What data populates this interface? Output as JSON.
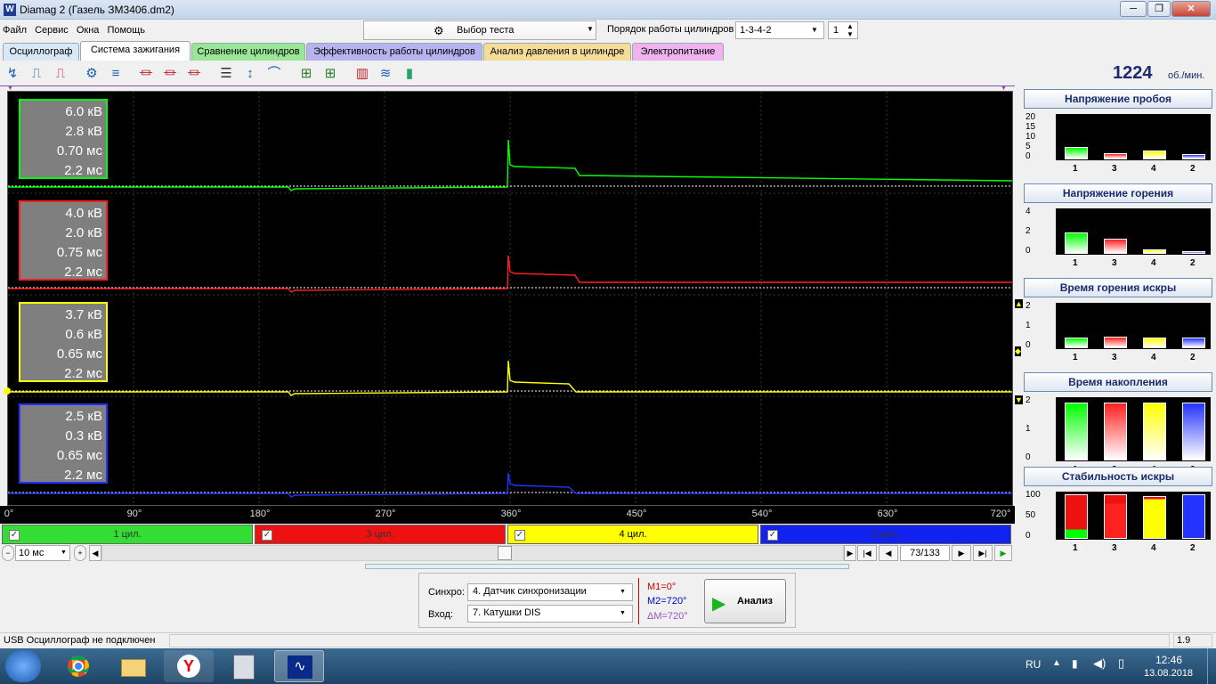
{
  "window": {
    "title": "Diamag 2 (Газель ЗМ3406.dm2)",
    "icon_name": "diamag-app-icon"
  },
  "menu": [
    "Файл",
    "Сервис",
    "Окна",
    "Помощь"
  ],
  "test_select": {
    "label": "Выбор теста"
  },
  "firing_order": {
    "label": "Порядок работы цилиндров",
    "value": "1-3-4-2",
    "cylinder": "1"
  },
  "tabs": [
    {
      "label": "Осциллограф",
      "color": "#d9e8f7"
    },
    {
      "label": "Система зажигания",
      "color": "#ffffff"
    },
    {
      "label": "Сравнение цилиндров",
      "color": "#99e699"
    },
    {
      "label": "Эффективность работы цилиндров",
      "color": "#b8b3f0"
    },
    {
      "label": "Анализ давления в цилиндре",
      "color": "#f5dd99"
    },
    {
      "label": "Электропитание",
      "color": "#efb3ef"
    }
  ],
  "rpm": {
    "value": "1224",
    "unit": "об./мин."
  },
  "channels": [
    {
      "name": "1 цил.",
      "color": "#00ff00",
      "bg": "#33dd33",
      "v1": "6.0 кВ",
      "v2": "2.8 кВ",
      "t1": "0.70 мс",
      "t2": "2.2 мс"
    },
    {
      "name": "3 цил.",
      "color": "#ff2020",
      "bg": "#ee1111",
      "v1": "4.0 кВ",
      "v2": "2.0 кВ",
      "t1": "0.75 мс",
      "t2": "2.2 мс"
    },
    {
      "name": "4 цил.",
      "color": "#ffff00",
      "bg": "#ffff00",
      "v1": "3.7 кВ",
      "v2": "0.6 кВ",
      "t1": "0.65 мс",
      "t2": "2.2 мс"
    },
    {
      "name": "2 цил.",
      "color": "#2233ff",
      "bg": "#1122ee",
      "v1": "2.5 кВ",
      "v2": "0.3 кВ",
      "t1": "0.65 мс",
      "t2": "2.2 мс"
    }
  ],
  "x_ticks": [
    "0°",
    "90°",
    "180°",
    "270°",
    "360°",
    "450°",
    "540°",
    "630°",
    "720°"
  ],
  "nav": {
    "timebase": "10 мс",
    "position": "73/133"
  },
  "panels": [
    {
      "title": "Напряжение пробоя",
      "y_ticks": [
        "20",
        "15",
        "10",
        "5",
        "0"
      ],
      "y_max": 20,
      "values": [
        6,
        2.8,
        4,
        2.5
      ]
    },
    {
      "title": "Напряжение горения",
      "y_ticks": [
        "4",
        "2",
        "0"
      ],
      "y_max": 5.5,
      "values": [
        2.8,
        2.0,
        0.6,
        0.3
      ]
    },
    {
      "title": "Время горения искры",
      "y_ticks": [
        "2",
        "1",
        "0"
      ],
      "y_max": 2.7,
      "values": [
        0.7,
        0.75,
        0.65,
        0.65
      ]
    },
    {
      "title": "Время накопления",
      "y_ticks": [
        "2",
        "1",
        "0"
      ],
      "y_max": 2.3,
      "values": [
        2.2,
        2.2,
        2.2,
        2.2
      ]
    },
    {
      "title": "Стабильность искры",
      "y_ticks": [
        "100",
        "50",
        "0"
      ],
      "y_max": 100,
      "values": [
        100,
        100,
        95,
        100
      ],
      "stable": [
        20,
        80,
        95,
        100
      ]
    }
  ],
  "panel_x_labels": [
    "1",
    "3",
    "4",
    "2"
  ],
  "sync": {
    "label": "Синхро:",
    "value": "4.  Датчик синхронизации"
  },
  "input": {
    "label": "Вход:",
    "value": "7.  Катушки DIS"
  },
  "markers": {
    "m1": "M1=0°",
    "m2": "M2=720°",
    "dm": "ΔM=720°"
  },
  "analyze": {
    "label": "Анализ"
  },
  "status": {
    "text": "USB Осциллограф не подключен",
    "version": "1.9"
  },
  "tray": {
    "lang": "RU",
    "time": "12:46",
    "date": "13.08.2018"
  }
}
